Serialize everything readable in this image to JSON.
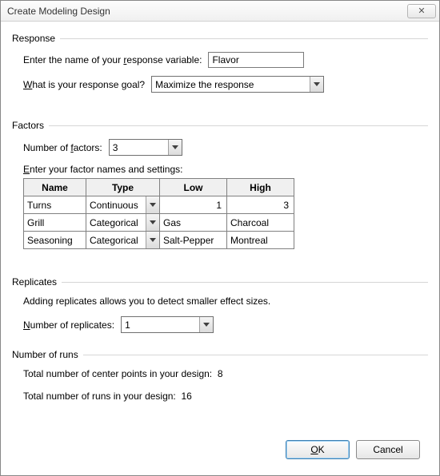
{
  "window": {
    "title": "Create Modeling Design",
    "close_glyph": "✕"
  },
  "response": {
    "group_title": "Response",
    "name_label_pre": "Enter the name of your ",
    "name_label_u": "r",
    "name_label_post": "esponse variable:",
    "name_value": "Flavor",
    "goal_label_u": "W",
    "goal_label_post": "hat is your response goal?",
    "goal_value": "Maximize the response"
  },
  "factors": {
    "group_title": "Factors",
    "num_label_pre": "Number of ",
    "num_label_u": "f",
    "num_label_post": "actors:",
    "num_value": "3",
    "table_label_u": "E",
    "table_label_post": "nter your factor names and settings:",
    "headers": {
      "name": "Name",
      "type": "Type",
      "low": "Low",
      "high": "High"
    },
    "rows": [
      {
        "name": "Turns",
        "type": "Continuous",
        "low": "1",
        "high": "3",
        "numeric": true
      },
      {
        "name": "Grill",
        "type": "Categorical",
        "low": "Gas",
        "high": "Charcoal",
        "numeric": false
      },
      {
        "name": "Seasoning",
        "type": "Categorical",
        "low": "Salt-Pepper",
        "high": "Montreal",
        "numeric": false
      }
    ]
  },
  "replicates": {
    "group_title": "Replicates",
    "desc": "Adding replicates allows you to detect smaller effect sizes.",
    "num_label_u": "N",
    "num_label_post": "umber of replicates:",
    "num_value": "1"
  },
  "runs": {
    "group_title": "Number of runs",
    "center_label": "Total number of center points in your design:",
    "center_value": "8",
    "total_label": "Total number of runs in your design:",
    "total_value": "16"
  },
  "buttons": {
    "ok_u": "O",
    "ok_post": "K",
    "cancel": "Cancel"
  }
}
